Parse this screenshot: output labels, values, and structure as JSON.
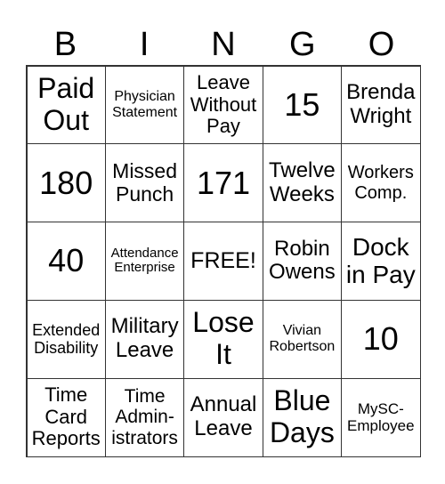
{
  "header": [
    "B",
    "I",
    "N",
    "G",
    "O"
  ],
  "cells": [
    [
      "Paid Out",
      "Physician Statement",
      "Leave Without Pay",
      "15",
      "Brenda Wright"
    ],
    [
      "180",
      "Missed Punch",
      "171",
      "Twelve Weeks",
      "Workers Comp."
    ],
    [
      "40",
      "Attendance Enterprise",
      "FREE!",
      "Robin Owens",
      "Dock in Pay"
    ],
    [
      "Extended Disability",
      "Military Leave",
      "Lose It",
      "Vivian Robertson",
      "10"
    ],
    [
      "Time Card Reports",
      "Time Admin-istrators",
      "Annual Leave",
      "Blue Days",
      "MySC-Employee"
    ]
  ]
}
